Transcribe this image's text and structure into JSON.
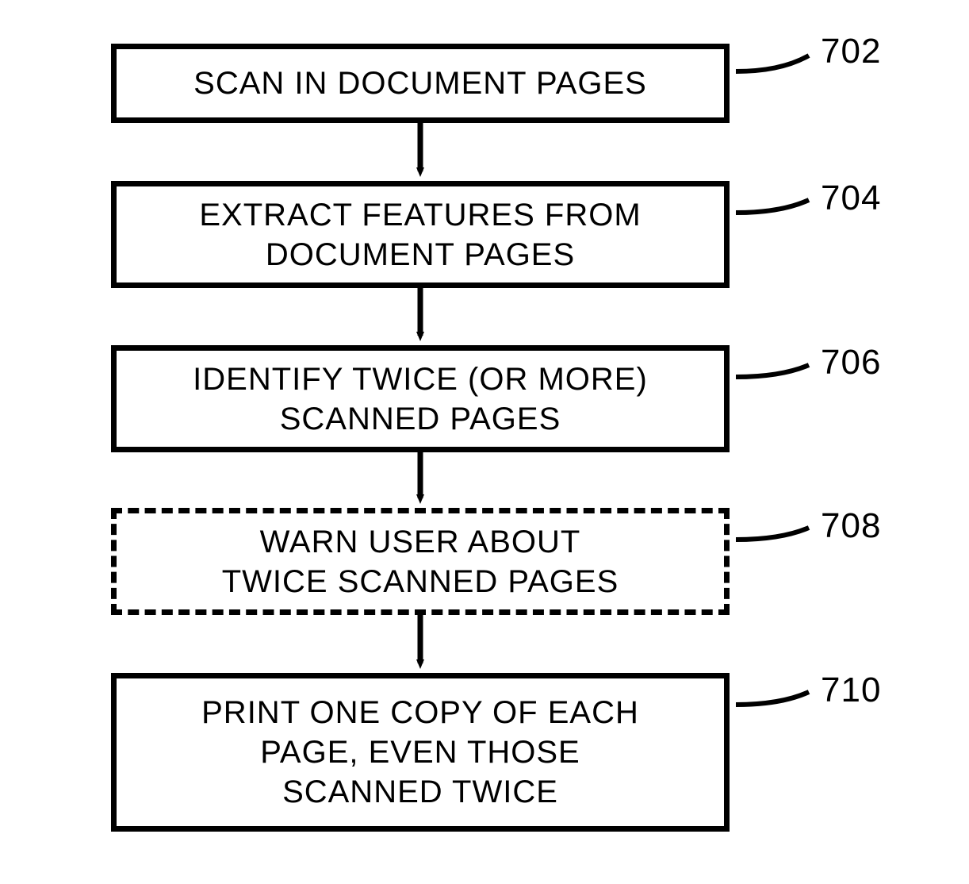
{
  "flow": {
    "steps": [
      {
        "id": "702",
        "text": "SCAN IN DOCUMENT PAGES",
        "label": "702",
        "dashed": false
      },
      {
        "id": "704",
        "text": "EXTRACT FEATURES FROM\nDOCUMENT PAGES",
        "label": "704",
        "dashed": false
      },
      {
        "id": "706",
        "text": "IDENTIFY TWICE (OR MORE)\nSCANNED PAGES",
        "label": "706",
        "dashed": false
      },
      {
        "id": "708",
        "text": "WARN USER ABOUT\nTWICE SCANNED PAGES",
        "label": "708",
        "dashed": true
      },
      {
        "id": "710",
        "text": "PRINT ONE COPY OF EACH\nPAGE, EVEN THOSE\nSCANNED TWICE",
        "label": "710",
        "dashed": false
      }
    ]
  }
}
